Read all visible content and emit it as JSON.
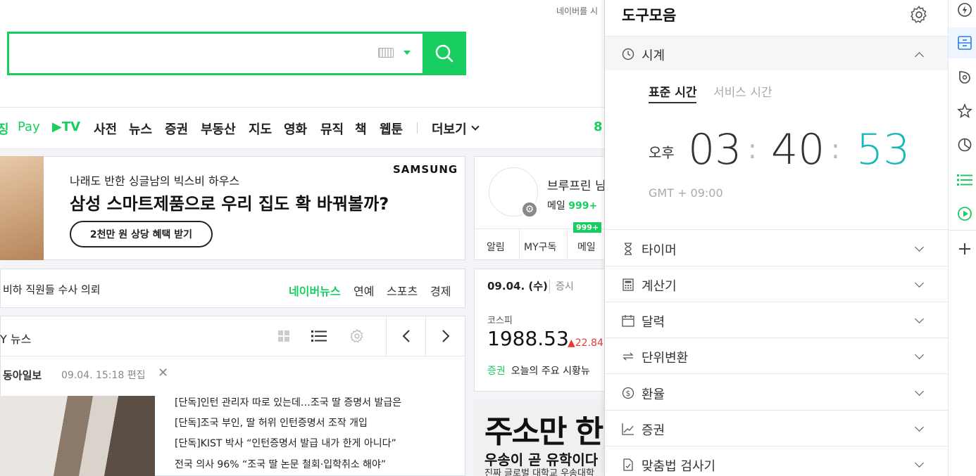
{
  "top_link": "네이버를 시",
  "search": {
    "placeholder": ""
  },
  "menu": {
    "items": [
      {
        "label": "징",
        "green": true
      },
      {
        "label": "Pay",
        "green": true
      },
      {
        "label": "▶TV",
        "green": true
      },
      {
        "label": "사전",
        "green": false
      },
      {
        "label": "뉴스",
        "green": false
      },
      {
        "label": "증권",
        "green": false
      },
      {
        "label": "부동산",
        "green": false
      },
      {
        "label": "지도",
        "green": false
      },
      {
        "label": "영화",
        "green": false
      },
      {
        "label": "뮤직",
        "green": false
      },
      {
        "label": "책",
        "green": false
      },
      {
        "label": "웹툰",
        "green": false
      }
    ],
    "more_label": "더보기",
    "partial_number": "8"
  },
  "ad": {
    "subtitle": "나래도 반한 싱글남의 빅스비 하우스",
    "title": "삼성 스마트제품으로 우리 집도 확 바꿔볼까?",
    "brand": "SAMSUNG",
    "button": "2천만 원 상당 혜택 받기"
  },
  "news_strip": {
    "headline": "비하 직원들 수사 의뢰",
    "tabs": [
      "네이버뉴스",
      "연예",
      "스포츠",
      "경제"
    ]
  },
  "news": {
    "title": "Y 뉴스",
    "press": "동아일보",
    "time": "09.04. 15:18 편집",
    "headlines": [
      "[단독]인턴 관리자 따로 있는데…조국 딸 증명서 발급은",
      "[단독]조국 부인, 딸 허위 인턴증명서 조작 개입",
      "[단독]KIST 박사 “인턴증명서 발급 내가 한게 아니다”",
      "전국 의사 96% “조국 딸 논문 철회·입학취소 해야”"
    ]
  },
  "login": {
    "name": "브루프린 님",
    "mail_label": "메일",
    "mail_count": "999+",
    "tabs": [
      "알림",
      "MY구독",
      "메일"
    ],
    "badge": "999+"
  },
  "stock": {
    "date": "09.04. (수)",
    "date_sub": "증시",
    "label": "코스피",
    "value": "1988.53",
    "change": "▲22.84",
    "link_tag": "증권",
    "link_text": "오늘의 주요 시황뉴"
  },
  "ad2": {
    "title": "주소만 한",
    "sub": "우송이 곧 유학이다",
    "sub2": "진짜 글로벌 대학교 우송대학"
  },
  "tools": {
    "title": "도구모음",
    "clock": {
      "label": "시계",
      "tab_standard": "표준 시간",
      "tab_service": "서비스 시간",
      "ampm": "오후",
      "hour": "03",
      "minute": "40",
      "second": "53",
      "gmt": "GMT + 09:00"
    },
    "sections": [
      "타이머",
      "계산기",
      "달력",
      "단위변환",
      "환율",
      "증권",
      "맞춤법 검사기"
    ]
  },
  "colors": {
    "accent": "#19ce60",
    "seconds": "#19b9b9",
    "stock_up": "#e53935"
  }
}
